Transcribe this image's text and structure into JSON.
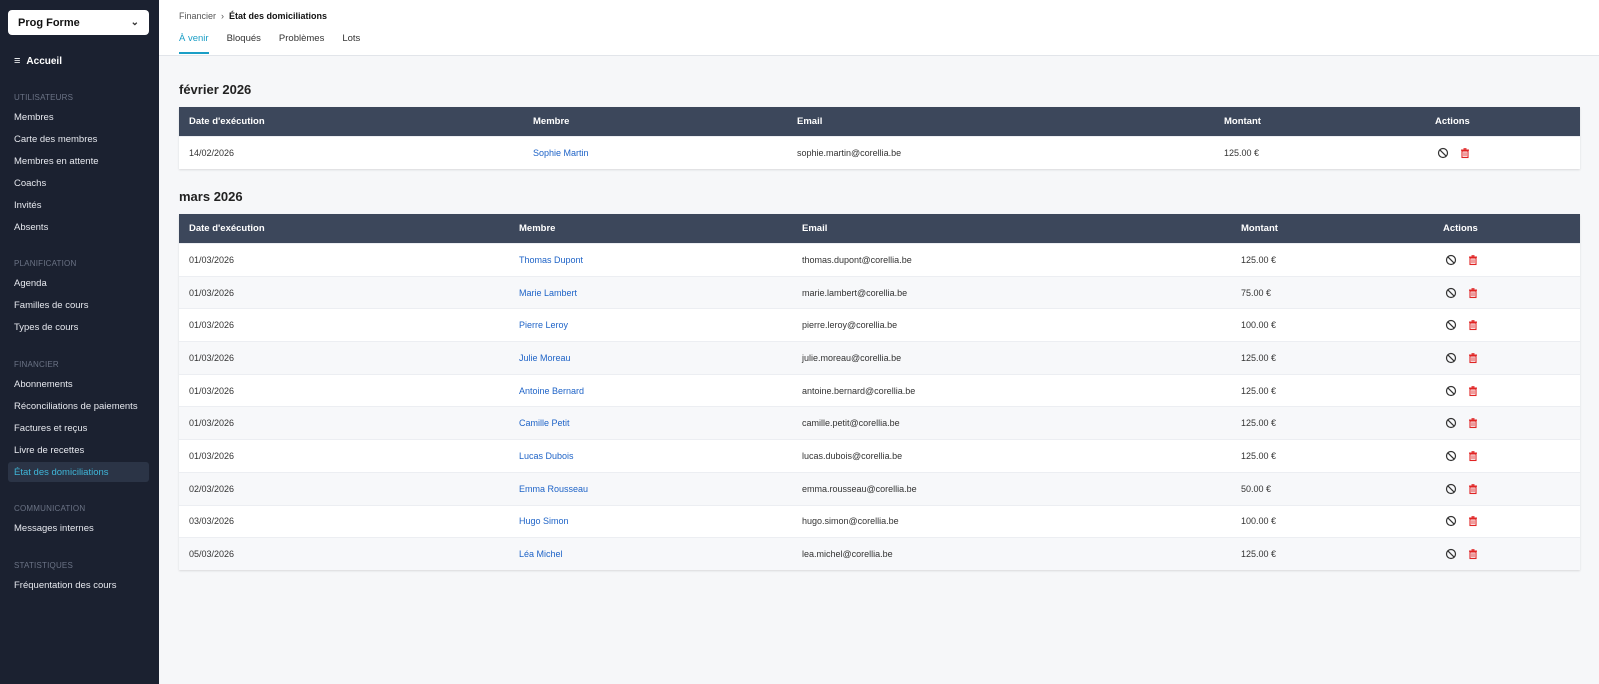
{
  "sidebar": {
    "org_name": "Prog Forme",
    "home": "Accueil",
    "sections": [
      {
        "title": "UTILISATEURS",
        "items": [
          "Membres",
          "Carte des membres",
          "Membres en attente",
          "Coachs",
          "Invités",
          "Absents"
        ]
      },
      {
        "title": "PLANIFICATION",
        "items": [
          "Agenda",
          "Familles de cours",
          "Types de cours"
        ]
      },
      {
        "title": "FINANCIER",
        "items": [
          "Abonnements",
          "Réconciliations de paiements",
          "Factures et reçus",
          "Livre de recettes",
          "État des domiciliations"
        ]
      },
      {
        "title": "COMMUNICATION",
        "items": [
          "Messages internes"
        ]
      },
      {
        "title": "STATISTIQUES",
        "items": [
          "Fréquentation des cours"
        ]
      }
    ],
    "active_item": "État des domiciliations"
  },
  "header": {
    "breadcrumb": [
      "Financier",
      "État des domiciliations"
    ],
    "tabs": [
      "À venir",
      "Bloqués",
      "Problèmes",
      "Lots"
    ],
    "active_tab": "À venir"
  },
  "table": {
    "columns": [
      "Date d'exécution",
      "Membre",
      "Email",
      "Montant",
      "Actions"
    ]
  },
  "groups": [
    {
      "title": "février 2026",
      "rows": [
        {
          "date": "14/02/2026",
          "member": "Sophie Martin",
          "email": "sophie.martin@corellia.be",
          "amount": "125.00 €"
        }
      ]
    },
    {
      "title": "mars 2026",
      "rows": [
        {
          "date": "01/03/2026",
          "member": "Thomas Dupont",
          "email": "thomas.dupont@corellia.be",
          "amount": "125.00 €"
        },
        {
          "date": "01/03/2026",
          "member": "Marie Lambert",
          "email": "marie.lambert@corellia.be",
          "amount": "75.00 €"
        },
        {
          "date": "01/03/2026",
          "member": "Pierre Leroy",
          "email": "pierre.leroy@corellia.be",
          "amount": "100.00 €"
        },
        {
          "date": "01/03/2026",
          "member": "Julie Moreau",
          "email": "julie.moreau@corellia.be",
          "amount": "125.00 €"
        },
        {
          "date": "01/03/2026",
          "member": "Antoine Bernard",
          "email": "antoine.bernard@corellia.be",
          "amount": "125.00 €"
        },
        {
          "date": "01/03/2026",
          "member": "Camille Petit",
          "email": "camille.petit@corellia.be",
          "amount": "125.00 €"
        },
        {
          "date": "01/03/2026",
          "member": "Lucas Dubois",
          "email": "lucas.dubois@corellia.be",
          "amount": "125.00 €"
        },
        {
          "date": "02/03/2026",
          "member": "Emma Rousseau",
          "email": "emma.rousseau@corellia.be",
          "amount": "50.00 €"
        },
        {
          "date": "03/03/2026",
          "member": "Hugo Simon",
          "email": "hugo.simon@corellia.be",
          "amount": "100.00 €"
        },
        {
          "date": "05/03/2026",
          "member": "Léa Michel",
          "email": "lea.michel@corellia.be",
          "amount": "125.00 €"
        }
      ]
    }
  ],
  "icons": {
    "block": "block-icon",
    "delete": "trash-icon"
  },
  "colors": {
    "sidebar_bg": "#1b2130",
    "header_row": "#3c475b",
    "accent": "#1a9ec6",
    "link": "#1e63c7",
    "danger": "#e02424"
  }
}
